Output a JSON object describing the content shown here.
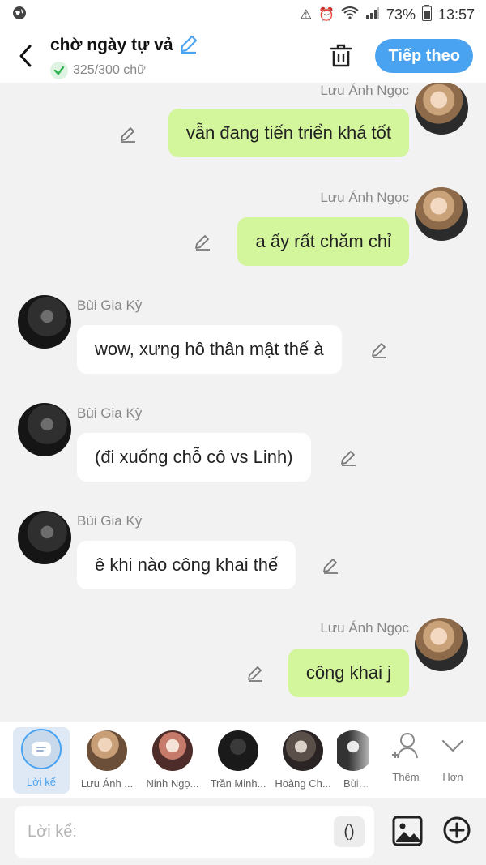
{
  "status_bar": {
    "battery": "73%",
    "time": "13:57"
  },
  "header": {
    "title": "chờ ngày tự vả",
    "word_count": "325/300 chữ",
    "next_label": "Tiếp theo"
  },
  "messages": [
    {
      "sender": "Lưu Ánh Ngọc",
      "text": "vẫn đang tiến triển khá tốt",
      "side": "right"
    },
    {
      "sender": "Lưu Ánh Ngọc",
      "text": "a ấy rất chăm chỉ",
      "side": "right"
    },
    {
      "sender": "Bùi Gia Kỳ",
      "text": "wow, xưng hô thân mật thế à",
      "side": "left"
    },
    {
      "sender": "Bùi Gia Kỳ",
      "text": "(đi xuống chỗ cô vs Linh)",
      "side": "left"
    },
    {
      "sender": "Bùi Gia Kỳ",
      "text": "ê khi nào công khai thế",
      "side": "left"
    },
    {
      "sender": "Lưu Ánh Ngọc",
      "text": "công khai j",
      "side": "right"
    }
  ],
  "character_bar": {
    "narrator": "Lời kể",
    "characters": [
      "Lưu Ánh ...",
      "Ninh Ngọ...",
      "Trần Minh...",
      "Hoàng Ch...",
      "Bùi G"
    ],
    "add_label": "Thêm",
    "more_label": "Hơn"
  },
  "composer": {
    "placeholder": "Lời kể:",
    "paren_label": "()"
  },
  "colors": {
    "accent": "#4aa3f0",
    "outgoing_bubble": "#d3f59c",
    "incoming_bubble": "#ffffff"
  }
}
